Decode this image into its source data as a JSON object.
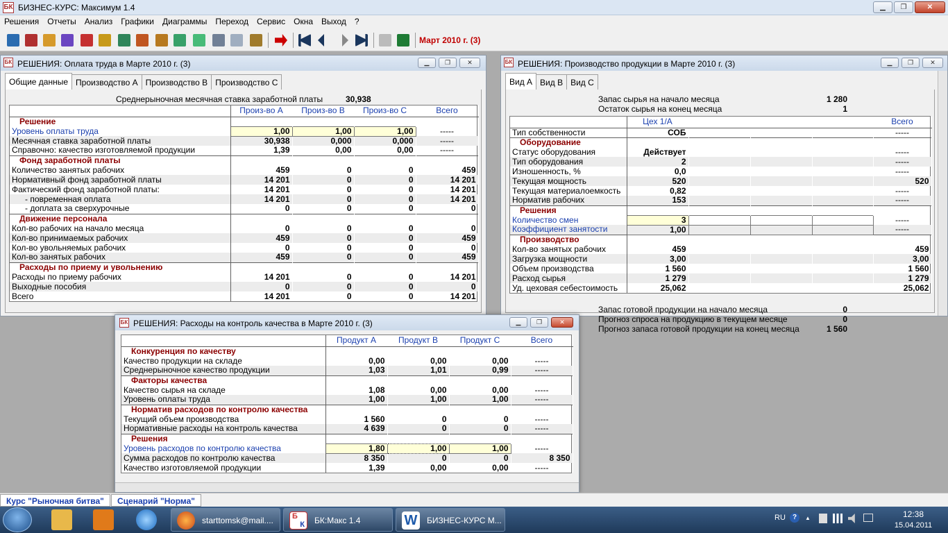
{
  "app": {
    "title": "БИЗНЕС-КУРС: Максимум 1.4",
    "icon_label": "БК"
  },
  "menu": [
    "Решения",
    "Отчеты",
    "Анализ",
    "Графики",
    "Диаграммы",
    "Переход",
    "Сервис",
    "Окна",
    "Выход",
    "?"
  ],
  "toolbar": {
    "period": "Март 2010 г. (3)"
  },
  "w1": {
    "title": "РЕШЕНИЯ: Оплата труда в Марте 2010 г. (3)",
    "tabs": [
      "Общие данные",
      "Производство А",
      "Производство В",
      "Производство С"
    ],
    "info_label": "Среднерыночная месячная ставка заработной платы",
    "info_value": "30,938",
    "headers": [
      "Произ-во А",
      "Произ-во В",
      "Произ-во С",
      "Всего"
    ],
    "rows": [
      {
        "t": "s",
        "label": "Решение"
      },
      {
        "t": "i",
        "label": "Уровень оплаты труда",
        "v": [
          "1,00",
          "1,00",
          "1,00",
          "-----"
        ]
      },
      {
        "t": "r",
        "label": "Месячная ставка заработной платы",
        "v": [
          "30,938",
          "0,000",
          "0,000",
          "-----"
        ]
      },
      {
        "t": "r",
        "label": "Справочно: качество изготовляемой продукции",
        "v": [
          "1,39",
          "0,00",
          "0,00",
          "-----"
        ]
      },
      {
        "t": "s",
        "label": "Фонд заработной платы"
      },
      {
        "t": "r",
        "label": "Количество занятых рабочих",
        "v": [
          "459",
          "0",
          "0",
          "459"
        ]
      },
      {
        "t": "r",
        "label": "Нормативный фонд заработной платы",
        "v": [
          "14 201",
          "0",
          "0",
          "14 201"
        ]
      },
      {
        "t": "r",
        "label": "Фактический фонд заработной платы:",
        "v": [
          "14 201",
          "0",
          "0",
          "14 201"
        ]
      },
      {
        "t": "r",
        "label": "- повременная оплата",
        "v": [
          "14 201",
          "0",
          "0",
          "14 201"
        ],
        "indent": true
      },
      {
        "t": "r",
        "label": "- доплата за сверхурочные",
        "v": [
          "0",
          "0",
          "0",
          "0"
        ],
        "indent": true
      },
      {
        "t": "s",
        "label": "Движение персонала"
      },
      {
        "t": "r",
        "label": "Кол-во рабочих на начало месяца",
        "v": [
          "0",
          "0",
          "0",
          "0"
        ]
      },
      {
        "t": "r",
        "label": "Кол-во принимаемых рабочих",
        "v": [
          "459",
          "0",
          "0",
          "459"
        ]
      },
      {
        "t": "r",
        "label": "Кол-во увольняемых рабочих",
        "v": [
          "0",
          "0",
          "0",
          "0"
        ]
      },
      {
        "t": "r",
        "label": "Кол-во занятых рабочих",
        "v": [
          "459",
          "0",
          "0",
          "459"
        ]
      },
      {
        "t": "s",
        "label": "Расходы по приему и увольнению"
      },
      {
        "t": "r",
        "label": "Расходы по приему рабочих",
        "v": [
          "14 201",
          "0",
          "0",
          "14 201"
        ]
      },
      {
        "t": "r",
        "label": "Выходные пособия",
        "v": [
          "0",
          "0",
          "0",
          "0"
        ]
      },
      {
        "t": "r",
        "label": "Всего",
        "v": [
          "14 201",
          "0",
          "0",
          "14 201"
        ]
      }
    ]
  },
  "w2": {
    "title": "РЕШЕНИЯ: Производство продукции в Марте 2010 г. (3)",
    "tabs": [
      "Вид А",
      "Вид В",
      "Вид С"
    ],
    "info_top": [
      {
        "label": "Запас сырья на начало месяца",
        "value": "1 280"
      },
      {
        "label": "Остаток сырья на конец месяца",
        "value": "1"
      }
    ],
    "headers": [
      "Цех 1/А",
      "",
      "",
      "",
      "Всего"
    ],
    "rows": [
      {
        "t": "r",
        "label": "Тип собственности",
        "v": [
          "СОБ",
          "",
          "",
          "",
          "-----"
        ]
      },
      {
        "t": "s",
        "label": "Оборудование"
      },
      {
        "t": "r",
        "label": "Статус оборудования",
        "v": [
          "Действует",
          "",
          "",
          "",
          "-----"
        ]
      },
      {
        "t": "r",
        "label": "Тип оборудования",
        "v": [
          "2",
          "",
          "",
          "",
          "-----"
        ]
      },
      {
        "t": "r",
        "label": "Изношенность, %",
        "v": [
          "0,0",
          "",
          "",
          "",
          "-----"
        ]
      },
      {
        "t": "r",
        "label": "Текущая мощность",
        "v": [
          "520",
          "",
          "",
          "",
          "520"
        ]
      },
      {
        "t": "r",
        "label": "Текущая материалоемкость",
        "v": [
          "0,82",
          "",
          "",
          "",
          "-----"
        ]
      },
      {
        "t": "r",
        "label": "Норматив рабочих",
        "v": [
          "153",
          "",
          "",
          "",
          "-----"
        ]
      },
      {
        "t": "s",
        "label": "Решения"
      },
      {
        "t": "i",
        "label": "Количество смен",
        "v": [
          "3",
          "",
          "",
          "",
          "-----"
        ]
      },
      {
        "t": "i",
        "label": "Коэффициент занятости",
        "v": [
          "1,00",
          "",
          "",
          "",
          "-----"
        ]
      },
      {
        "t": "s",
        "label": "Производство"
      },
      {
        "t": "r",
        "label": "Кол-во занятых рабочих",
        "v": [
          "459",
          "",
          "",
          "",
          "459"
        ]
      },
      {
        "t": "r",
        "label": "Загрузка мощности",
        "v": [
          "3,00",
          "",
          "",
          "",
          "3,00"
        ]
      },
      {
        "t": "r",
        "label": "Объем производства",
        "v": [
          "1 560",
          "",
          "",
          "",
          "1 560"
        ]
      },
      {
        "t": "r",
        "label": "Расход сырья",
        "v": [
          "1 279",
          "",
          "",
          "",
          "1 279"
        ]
      },
      {
        "t": "r",
        "label": "Уд. цеховая себестоимость",
        "v": [
          "25,062",
          "",
          "",
          "",
          "25,062"
        ]
      }
    ],
    "info_bottom": [
      {
        "label": "Запас готовой продукции на начало месяца",
        "value": "0"
      },
      {
        "label": "Прогноз спроса на продукцию в текущем месяце",
        "value": "0"
      },
      {
        "label": "Прогноз запаса готовой продукции на конец месяца",
        "value": "1 560"
      }
    ]
  },
  "w3": {
    "title": "РЕШЕНИЯ: Расходы на контроль качества в Марте 2010 г. (3)",
    "headers": [
      "Продукт А",
      "Продукт В",
      "Продукт С",
      "Всего"
    ],
    "rows": [
      {
        "t": "s",
        "label": "Конкуренция по качеству"
      },
      {
        "t": "r",
        "label": "Качество продукции на складе",
        "v": [
          "0,00",
          "0,00",
          "0,00",
          "-----"
        ]
      },
      {
        "t": "r",
        "label": "Среднерыночное качество продукции",
        "v": [
          "1,03",
          "1,01",
          "0,99",
          "-----"
        ]
      },
      {
        "t": "s",
        "label": "Факторы качества"
      },
      {
        "t": "r",
        "label": "Качество сырья на складе",
        "v": [
          "1,08",
          "0,00",
          "0,00",
          "-----"
        ]
      },
      {
        "t": "r",
        "label": "Уровень оплаты труда",
        "v": [
          "1,00",
          "1,00",
          "1,00",
          "-----"
        ]
      },
      {
        "t": "s",
        "label": "Норматив расходов по контролю качества"
      },
      {
        "t": "r",
        "label": "Текущий объем производства",
        "v": [
          "1 560",
          "0",
          "0",
          "-----"
        ]
      },
      {
        "t": "r",
        "label": "Нормативные расходы на контроль качества",
        "v": [
          "4 639",
          "0",
          "0",
          "-----"
        ]
      },
      {
        "t": "s",
        "label": "Решения"
      },
      {
        "t": "i",
        "label": "Уровень расходов по контролю качества",
        "v": [
          "1,80",
          "1,00",
          "1,00",
          "-----"
        ]
      },
      {
        "t": "r",
        "label": "Сумма расходов по контролю качества",
        "v": [
          "8 350",
          "0",
          "0",
          "8 350"
        ]
      },
      {
        "t": "r",
        "label": "Качество изготовляемой продукции",
        "v": [
          "1,39",
          "0,00",
          "0,00",
          "-----"
        ]
      }
    ]
  },
  "statusbar": {
    "course": "Курс \"Рыночная битва\"",
    "scenario": "Сценарий \"Норма\""
  },
  "taskbar": {
    "items": [
      "starttomsk@mail....",
      "БК:Макс 1.4",
      "БИЗНЕС-КУРС М..."
    ],
    "lang": "RU",
    "time": "12:38",
    "date": "15.04.2011",
    "bk_icon_top": "Б",
    "bk_icon_bottom": "К",
    "word_icon": "W"
  }
}
